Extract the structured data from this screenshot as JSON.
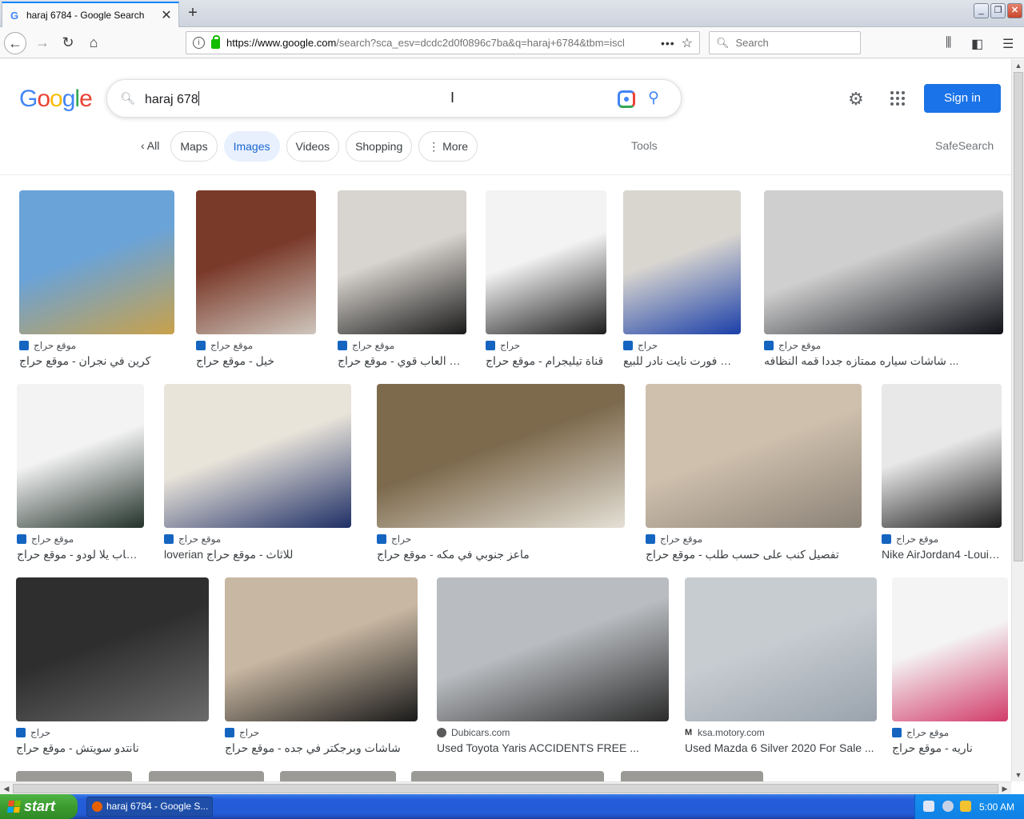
{
  "browser": {
    "tab_title": "haraj 6784 - Google Search",
    "tab_favicon": "G",
    "url_host": "https://www.google.com",
    "url_rest": "/search?sca_esv=dcdc2d0f0896c7ba&q=haraj+6784&tbm=iscl",
    "search_placeholder": "Search"
  },
  "google": {
    "logo": [
      "G",
      "o",
      "o",
      "g",
      "l",
      "e"
    ],
    "query": "haraj 678",
    "sign_in": "Sign in",
    "chips": [
      "All",
      "Maps",
      "Images",
      "Videos",
      "Shopping",
      "More"
    ],
    "active_chip": "Images",
    "tools": "Tools",
    "safesearch": "SafeSearch"
  },
  "results": [
    {
      "source": "موقع حراج",
      "title": "كرين في نجران - موقع حراج",
      "colors": [
        "#6aa3d8",
        "#c9a14a"
      ]
    },
    {
      "source": "موقع حراج",
      "title": "خيل - موقع حراج",
      "colors": [
        "#7a3a2a",
        "#cfc6bd"
      ]
    },
    {
      "source": "موقع حراج",
      "title": "بي سي العاب قوي - موقع حراج",
      "colors": [
        "#d8d4cf",
        "#1a1a1a"
      ]
    },
    {
      "source": "حراج",
      "title": "قناة تيليجرام - موقع حراج",
      "colors": [
        "#f3f3f3",
        "#1d1d1d"
      ]
    },
    {
      "source": "حراج",
      "title": "حساب فورت نايت نادر للبيع ...",
      "colors": [
        "#d9d6d0",
        "#1b3fa8"
      ]
    },
    {
      "source": "موقع حراج",
      "title": "شاشات سياره ممتازه جددا قمه النظافه ...",
      "colors": [
        "#cfcfcf",
        "#101218"
      ]
    },
    {
      "source": "موقع حراج",
      "title": "بيع حساب يلا لودو - موقع حراج",
      "colors": [
        "#f3f3f3",
        "#22312a"
      ]
    },
    {
      "source": "موقع حراج",
      "title": "loverian للاثاث - موقع حراج",
      "colors": [
        "#e9e4da",
        "#1f2f66"
      ]
    },
    {
      "source": "حراج",
      "title": "ماعز جنوبي في مكه - موقع حراج",
      "colors": [
        "#7d6a4d",
        "#e5e0d6"
      ]
    },
    {
      "source": "موقع حراج",
      "title": "تفصيل كنب على حسب طلب - موقع حراج",
      "colors": [
        "#cfc0ad",
        "#8b8277"
      ]
    },
    {
      "source": "موقع حراج",
      "title": "Nike AirJordan4 -Louis...",
      "colors": [
        "#e8e8e8",
        "#1c1c1c"
      ]
    },
    {
      "source": "حراج",
      "title": "نانتدو سويتش - موقع حراج",
      "colors": [
        "#2e2e2e",
        "#6b6b6b"
      ]
    },
    {
      "source": "حراج",
      "title": "شاشات وبرجكتر في جده - موقع حراج",
      "colors": [
        "#c8b7a2",
        "#1a1a1a"
      ]
    },
    {
      "source": "Dubicars.com",
      "title": "Used Toyota Yaris ACCIDENTS FREE ...",
      "colors": [
        "#b9bcc0",
        "#2b2b2b"
      ]
    },
    {
      "source": "ksa.motory.com",
      "title": "Used Mazda 6 Silver 2020 For Sale ...",
      "colors": [
        "#c7ccd1",
        "#9aa3ad"
      ]
    },
    {
      "source": "موقع حراج",
      "title": "ناريه - موقع حراج",
      "colors": [
        "#f4f4f4",
        "#d23c6b"
      ]
    }
  ],
  "taskbar": {
    "start": "start",
    "task": "haraj 6784 - Google S...",
    "clock": "5:00 AM"
  },
  "colors": {
    "accent": "#1a73e8",
    "start_green": "#3c9b2f",
    "taskbar_blue": "#245edb"
  }
}
